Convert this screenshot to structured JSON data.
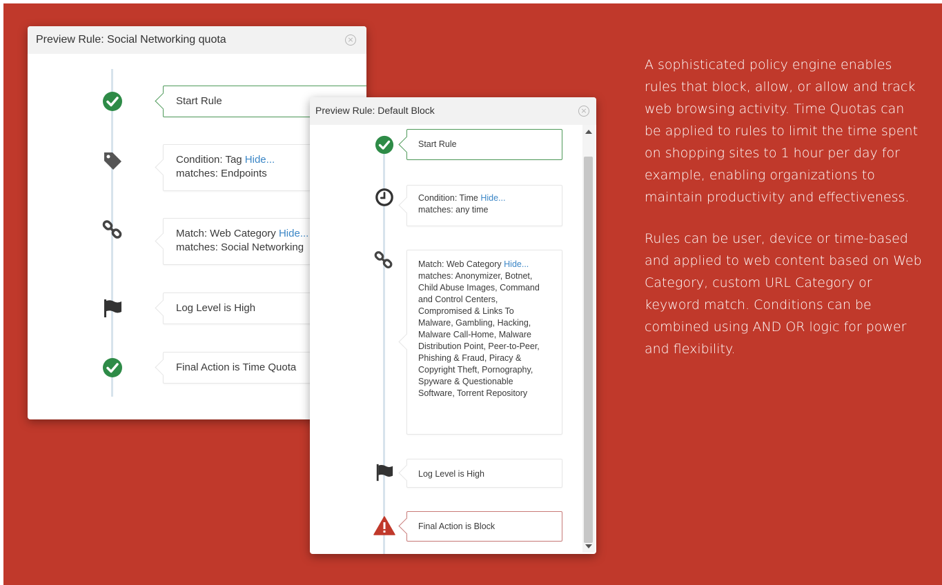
{
  "colors": {
    "background": "#c0392b",
    "success_green": "#2e8b47",
    "block_red": "#c0392b",
    "link_blue": "#3b86c6"
  },
  "window1": {
    "title": "Preview Rule: Social Networking quota",
    "close_glyph": "×",
    "steps": [
      {
        "icon": "check-circle-icon",
        "line1": "Start Rule"
      },
      {
        "icon": "tag-icon",
        "line1": "Condition: Tag",
        "link": "Hide...",
        "line2": "matches: Endpoints"
      },
      {
        "icon": "link-icon",
        "line1": "Match: Web Category",
        "link": "Hide...",
        "line2": "matches: Social Networking"
      },
      {
        "icon": "flag-icon",
        "line1": "Log Level is High"
      },
      {
        "icon": "check-circle-icon",
        "line1": "Final Action is Time Quota"
      }
    ]
  },
  "window2": {
    "title": "Preview Rule: Default Block",
    "close_glyph": "×",
    "steps": [
      {
        "icon": "check-circle-icon",
        "line1": "Start Rule"
      },
      {
        "icon": "clock-icon",
        "line1": "Condition: Time",
        "link": "Hide...",
        "line2": "matches: any time"
      },
      {
        "icon": "link-icon",
        "line1": "Match: Web Category",
        "link": "Hide...",
        "line2": "matches: Anonymizer, Botnet, Child Abuse Images, Command and Control Centers, Compromised & Links To Malware, Gambling, Hacking, Malware Call-Home, Malware Distribution Point, Peer-to-Peer, Phishing & Fraud, Piracy & Copyright Theft, Pornography, Spyware & Questionable Software, Torrent Repository"
      },
      {
        "icon": "flag-icon",
        "line1": "Log Level is High"
      },
      {
        "icon": "warning-icon",
        "line1": "Final Action is Block"
      }
    ]
  },
  "description": {
    "paragraph1": "A sophisticated policy engine enables rules that block, allow, or allow and track web browsing activity. Time Quotas can be applied to rules to limit the time spent on shopping sites to 1 hour per day for example, enabling organizations to maintain productivity and effectiveness.",
    "paragraph2": "Rules can be user, device or time-based and applied to web content based on Web Category, custom URL Category or keyword match. Conditions can be combined using AND OR logic for power and flexibility."
  }
}
